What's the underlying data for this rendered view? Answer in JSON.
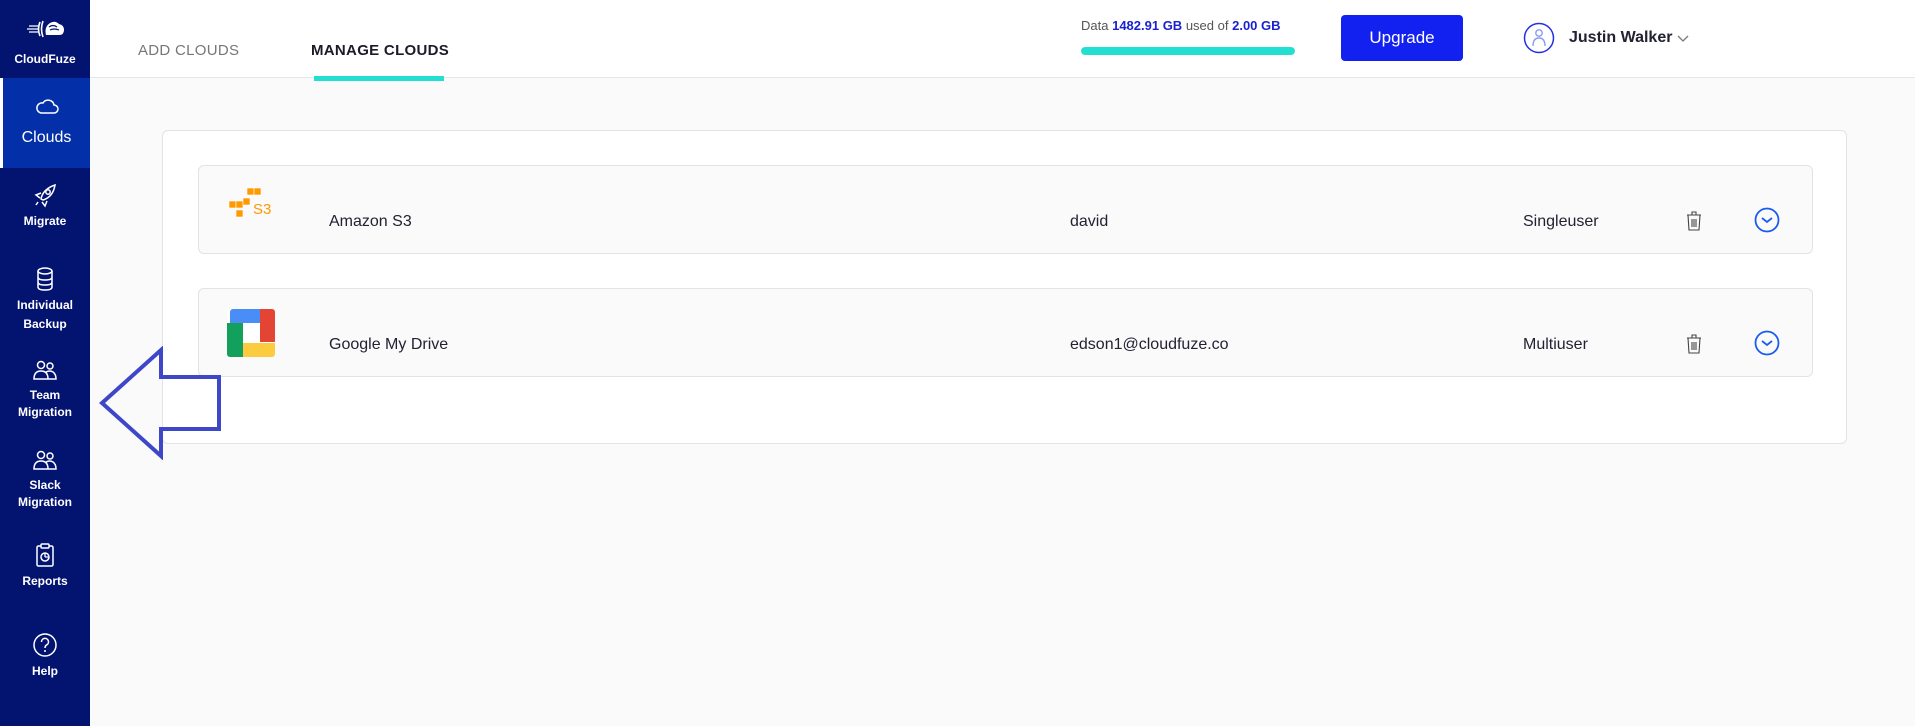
{
  "sidebar": {
    "brand": "CloudFuze",
    "items": [
      {
        "label": "Clouds",
        "icon": "cloud-icon",
        "active": true
      },
      {
        "label": "Migrate",
        "icon": "rocket-icon"
      },
      {
        "label": "Individual Backup",
        "icon": "database-icon"
      },
      {
        "label": "Team Migration",
        "icon": "users-icon"
      },
      {
        "label": "Slack Migration",
        "icon": "users-icon"
      },
      {
        "label": "Reports",
        "icon": "clipboard-report-icon"
      },
      {
        "label": "Help",
        "icon": "help-circle-icon"
      }
    ]
  },
  "header": {
    "tabs": [
      {
        "label": "ADD CLOUDS",
        "active": false
      },
      {
        "label": "MANAGE CLOUDS",
        "active": true
      }
    ],
    "usage": {
      "prefix": "Data",
      "used": "1482.91 GB",
      "middle": "used of",
      "total": "2.00 GB",
      "fill_percent": 100
    },
    "upgrade_label": "Upgrade",
    "user_name": "Justin Walker"
  },
  "colors": {
    "sidebar_bg": "#031370",
    "sidebar_active": "#0330a8",
    "accent_teal": "#22dfd2",
    "button_blue": "#1220f0"
  },
  "clouds": [
    {
      "name": "Amazon S3",
      "account": "david",
      "type": "Singleuser",
      "logo": "amazon-s3-logo"
    },
    {
      "name": "Google My Drive",
      "account": "edson1@cloudfuze.co",
      "type": "Multiuser",
      "logo": "google-drive-logo"
    }
  ]
}
